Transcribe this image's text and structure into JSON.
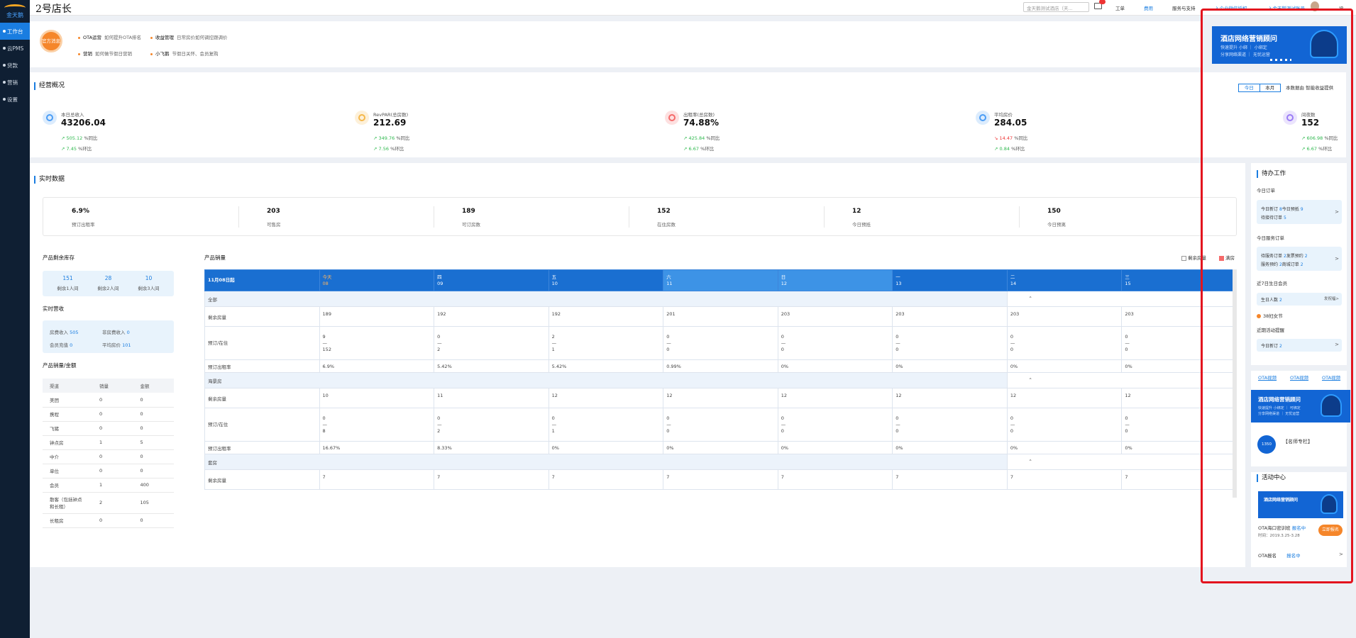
{
  "app": {
    "logo_text": "金天鹅",
    "page_title": "2号店长"
  },
  "sidebar": {
    "items": [
      "工作台",
      "云PMS",
      "贷款",
      "营销",
      "设置"
    ]
  },
  "topbar": {
    "search_placeholder": "金天鹅测试酒店（天...",
    "links": [
      "工单",
      "费用",
      "服务与支持",
      "入企业微信授权",
      "入金天鹅测试账号",
      "设"
    ]
  },
  "notice": {
    "logo_text": "官方消息",
    "items": [
      {
        "title": "OTA运营",
        "desc": "如何提升OTA排名"
      },
      {
        "title": "收益管理",
        "desc": "日常房价如何调控跟调价"
      },
      {
        "title": "营销",
        "desc": "如何做节假日营销"
      },
      {
        "title": "小飞鹅",
        "desc": "节假日关怀、会员复购"
      }
    ]
  },
  "overview": {
    "title": "经营概况",
    "toggle": [
      "今日",
      "本月"
    ],
    "note": "本数据由 智能收益提供",
    "kpis": [
      {
        "label": "本日总收入",
        "value": "43206.04",
        "yoy": "505.12",
        "mom": "7.45",
        "color": "#4a9cf5",
        "bg": "#dcecfd",
        "yoy_dir": "up"
      },
      {
        "label": "RevPAR(总房数)",
        "value": "212.69",
        "yoy": "349.76",
        "mom": "7.56",
        "color": "#f5b84a",
        "bg": "#fdf0d9",
        "yoy_dir": "up"
      },
      {
        "label": "出租率(总房数)",
        "value": "74.88%",
        "yoy": "425.84",
        "mom": "6.67",
        "color": "#f56a6a",
        "bg": "#fde0e0",
        "yoy_dir": "up"
      },
      {
        "label": "平均房价",
        "value": "284.05",
        "yoy": "14.47",
        "mom": "0.84",
        "color": "#4a9cf5",
        "bg": "#dcecfd",
        "yoy_dir": "down"
      },
      {
        "label": "间夜数",
        "value": "152",
        "yoy": "606.98",
        "mom": "6.67",
        "color": "#9a7cf5",
        "bg": "#ebe4fd",
        "yoy_dir": "up"
      }
    ],
    "yoy_suffix": "%同比",
    "mom_suffix": "%环比"
  },
  "realtime": {
    "title": "实时数据",
    "items": [
      {
        "value": "6.9%",
        "label": "预订出租率"
      },
      {
        "value": "203",
        "label": "可售房"
      },
      {
        "value": "189",
        "label": "可订房数"
      },
      {
        "value": "152",
        "label": "在住房数"
      },
      {
        "value": "12",
        "label": "今日预抵"
      },
      {
        "value": "150",
        "label": "今日预离"
      }
    ]
  },
  "stock": {
    "title": "产品剩余库存",
    "items": [
      {
        "value": "151",
        "label": "剩余1人间"
      },
      {
        "value": "28",
        "label": "剩余2人间"
      },
      {
        "value": "10",
        "label": "剩余3人间"
      }
    ]
  },
  "income": {
    "title": "实时营收",
    "room_label": "房费收入",
    "room_value": "505",
    "nonroom_label": "非房费收入",
    "nonroom_value": "0",
    "member_label": "会员充值",
    "member_value": "0",
    "avg_label": "平均房价",
    "avg_value": "101"
  },
  "channel": {
    "title": "产品销量/金额",
    "headers": [
      "渠道",
      "销量",
      "金额"
    ],
    "rows": [
      [
        "美团",
        "0",
        "0"
      ],
      [
        "携程",
        "0",
        "0"
      ],
      [
        "飞猪",
        "0",
        "0"
      ],
      [
        "钟点房",
        "1",
        "5"
      ],
      [
        "中介",
        "0",
        "0"
      ],
      [
        "单位",
        "0",
        "0"
      ],
      [
        "会员",
        "1",
        "400"
      ],
      [
        "散客（包括钟点和长租）",
        "2",
        "105"
      ],
      [
        "长租房",
        "0",
        "0"
      ]
    ]
  },
  "sales": {
    "title": "产品销量",
    "legend_remaining": "剩余房量",
    "legend_full": "满房",
    "corner": "11月08日起",
    "days": [
      {
        "week": "今天",
        "date": "08"
      },
      {
        "week": "四",
        "date": "09"
      },
      {
        "week": "五",
        "date": "10"
      },
      {
        "week": "六",
        "date": "11"
      },
      {
        "week": "日",
        "date": "12"
      },
      {
        "week": "一",
        "date": "13"
      },
      {
        "week": "二",
        "date": "14"
      },
      {
        "week": "三",
        "date": "15"
      }
    ],
    "groups": [
      {
        "name": "全部",
        "remain_label": "剩余房量",
        "remain": [
          "189",
          "192",
          "192",
          "201",
          "203",
          "203",
          "203",
          "203"
        ],
        "book_label": "预订/在住",
        "book": [
          "9",
          "0",
          "2",
          "0",
          "0",
          "0",
          "0",
          "0"
        ],
        "stay": [
          "152",
          "2",
          "1",
          "0",
          "0",
          "0",
          "0",
          "0"
        ],
        "rate_label": "预订出租率",
        "rate": [
          "6.9%",
          "5.42%",
          "5.42%",
          "0.99%",
          "0%",
          "0%",
          "0%",
          "0%"
        ]
      },
      {
        "name": "海景房",
        "remain_label": "剩余房量",
        "remain": [
          "10",
          "11",
          "12",
          "12",
          "12",
          "12",
          "12",
          "12"
        ],
        "book_label": "预订/在住",
        "book": [
          "0",
          "0",
          "0",
          "0",
          "0",
          "0",
          "0",
          "0"
        ],
        "stay": [
          "8",
          "2",
          "1",
          "0",
          "0",
          "0",
          "0",
          "0"
        ],
        "rate_label": "预订出租率",
        "rate": [
          "16.67%",
          "8.33%",
          "0%",
          "0%",
          "0%",
          "0%",
          "0%",
          "0%"
        ]
      },
      {
        "name": "套房",
        "remain_label": "剩余房量",
        "remain": [
          "7",
          "7",
          "7",
          "7",
          "7",
          "7",
          "7",
          "7"
        ]
      }
    ]
  },
  "todo": {
    "title": "待办工作",
    "orders_title": "今日订单",
    "new_label": "今日新订",
    "new_value": "8",
    "arrive_label": "今日预抵",
    "arrive_value": "9",
    "pending_label": "待接待订单",
    "pending_value": "5",
    "service_title": "今日服务订单",
    "svc_pending_label": "待服务订单",
    "svc_pending_value": "2",
    "invoice_label": "发票预约",
    "invoice_value": "2",
    "svc_book_label": "服务预约",
    "svc_book_value": "2",
    "trans_label": "商城订单",
    "trans_value": "2",
    "birthday_title": "近7日生日会员",
    "birthday_label": "生日人数",
    "birthday_value": "2",
    "birthday_more": "发祝福>",
    "festival": "38妇女节",
    "activity_title": "近期活动提醒",
    "activity_label": "今日新订",
    "activity_value": "2",
    "arrow": ">"
  },
  "ota_tabs": [
    "OTA视频",
    "OTA视频",
    "OTA视频"
  ],
  "banner_top": {
    "title": "酒店网络营销顾问",
    "sub1": "快速提升 小绑 ｜ 小绑定",
    "sub2": "分享网络渠道 ｜ 无忧运营"
  },
  "banner_mid": {
    "title": "酒店网络营销顾问",
    "sub1": "快速提升 小绑定 ｜ 可绑定",
    "sub2": "分享网络渠道 ｜ 无忧运营"
  },
  "expert": {
    "badge": "1350",
    "label": "【名师专栏】"
  },
  "events": {
    "title": "活动中心",
    "banner_title": "酒店网络营销顾问",
    "name": "OTA海口密训班",
    "status": "报名中",
    "time_label": "时间：2019.3.25-3.28",
    "sign": "立即报名",
    "bottom_name": "OTA报名",
    "bottom_status": "报名中",
    "bottom_arrow": ">"
  },
  "colors": {
    "primary": "#1a7de0",
    "accent": "#f5862a",
    "sidebar": "#0f1f33",
    "highlight": "#e3141e"
  }
}
